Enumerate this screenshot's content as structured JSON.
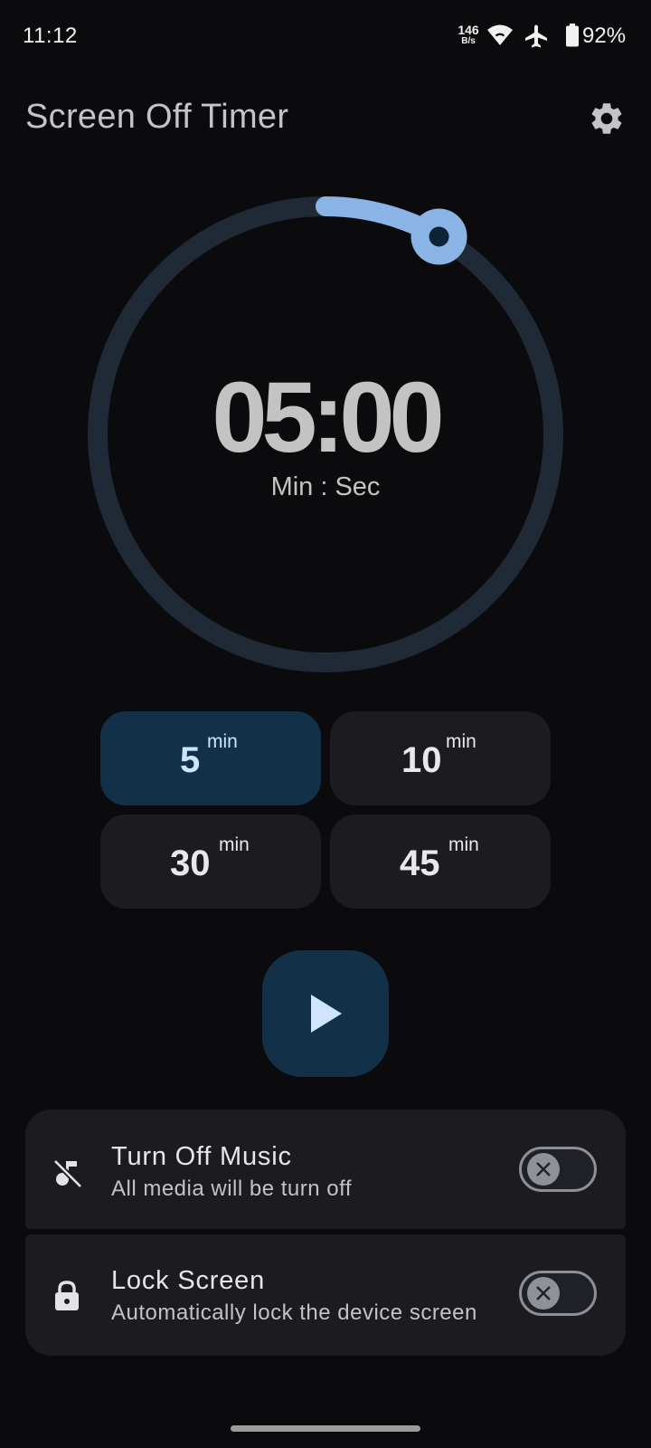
{
  "status_bar": {
    "time": "11:12",
    "net_speed_value": "146",
    "net_speed_unit": "B/s",
    "battery": "92%",
    "icons": [
      "wifi-icon",
      "airplane-mode-icon",
      "battery-icon"
    ]
  },
  "app": {
    "title": "Screen Off Timer",
    "settings_icon": "gear-icon"
  },
  "timer": {
    "display": "05:00",
    "unit_label": "Min : Sec",
    "progress_fraction": 0.083
  },
  "presets": [
    {
      "value": "5",
      "unit": "min",
      "selected": true
    },
    {
      "value": "10",
      "unit": "min",
      "selected": false
    },
    {
      "value": "30",
      "unit": "min",
      "selected": false
    },
    {
      "value": "45",
      "unit": "min",
      "selected": false
    }
  ],
  "play_button": {
    "icon": "play-icon"
  },
  "options": [
    {
      "title": "Turn Off Music",
      "subtitle": "All media will be turn off",
      "icon": "music-off-icon",
      "enabled": false
    },
    {
      "title": "Lock Screen",
      "subtitle": "Automatically lock the device screen",
      "icon": "lock-icon",
      "enabled": false
    }
  ],
  "colors": {
    "background": "#0b0b0d",
    "accent": "#8ab4e6",
    "track": "#1f2a36",
    "selected_chip": "#133049",
    "card": "#1c1b1f"
  }
}
